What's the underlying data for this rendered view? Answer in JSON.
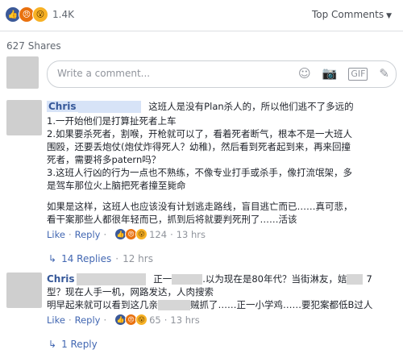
{
  "header": {
    "reaction_count": "1.4K",
    "top_comments_label": "Top Comments",
    "shares_label": "627 Shares"
  },
  "composer": {
    "placeholder": "Write a comment..."
  },
  "comments": [
    {
      "name": "Chris",
      "text_line1": "这班人是没有Plan杀人的，所以他们逃不了多远的",
      "lines": [
        "1.一开始他们是打算扯死者上车",
        "2.如果要杀死者，割喉，开枪就可以了，看着死者断气，根本不是一大班人",
        "围殴，还要丢炮仗(炮仗炸得死人？幼稚)，然后看到死者起到来，再来回撞",
        "死者，需要将多patern吗？",
        "3.这班人行凶的行为一点也不熟练，不像专业打手或杀手，像打流氓架，多",
        "是驾车那位火上脑把死者撞至毙命"
      ],
      "para2": [
        "如果是这样，这班人也应该没有计划逃走路线，盲目逃亡而已……真可悲，",
        "看干案那些人都很年轻而已，抓到后将就要判死刑了……活该"
      ],
      "like": "Like",
      "reply": "Reply",
      "reaction_count": "124",
      "time": "13 hrs",
      "replies_label": "14 Replies",
      "replies_time": "12 hrs"
    },
    {
      "name": "Chris",
      "line1_a": "正一",
      "line1_b": ".以为现在是80年代？当街淋友，娮",
      "line1_c": "7",
      "line2": "型？现在人手一机，网路发达，人肉搜索",
      "line3_a": "明早起来就可以看到这几亲",
      "line3_b": "贼抓了……正一小学鸡……要犯案都低B过人",
      "like": "Like",
      "reply": "Reply",
      "reaction_count": "65",
      "time": "13 hrs",
      "replies_label": "1 Reply"
    }
  ]
}
